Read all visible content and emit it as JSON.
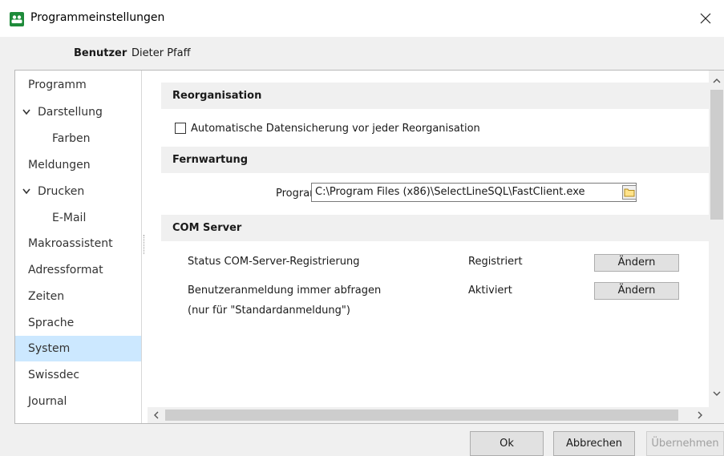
{
  "window": {
    "title": "Programmeinstellungen",
    "close_glyph": "✕"
  },
  "user": {
    "label": "Benutzer",
    "name": "Dieter Pfaff"
  },
  "nav": {
    "items": [
      {
        "label": "Programm"
      },
      {
        "label": "Darstellung",
        "expanded": true
      },
      {
        "label": "Farben"
      },
      {
        "label": "Meldungen"
      },
      {
        "label": "Drucken",
        "expanded": true
      },
      {
        "label": "E-Mail"
      },
      {
        "label": "Makroassistent"
      },
      {
        "label": "Adressformat"
      },
      {
        "label": "Zeiten"
      },
      {
        "label": "Sprache"
      },
      {
        "label": "System",
        "selected": true
      },
      {
        "label": "Swissdec"
      },
      {
        "label": "Journal"
      }
    ]
  },
  "sections": {
    "reorg": {
      "title": "Reorganisation",
      "checkbox_label": "Automatische Datensicherung vor jeder Reorganisation",
      "checked": false
    },
    "fernwartung": {
      "title": "Fernwartung",
      "program_label": "Programm",
      "program_path": "C:\\Program Files (x86)\\SelectLineSQL\\FastClient.exe"
    },
    "com": {
      "title": "COM Server",
      "rows": [
        {
          "label": "Status COM-Server-Registrierung",
          "value": "Registriert",
          "button": "Ändern"
        },
        {
          "label": "Benutzeranmeldung immer abfragen",
          "value": "Aktiviert",
          "button": "Ändern"
        }
      ],
      "note": "(nur für \"Standardanmeldung\")"
    }
  },
  "footer": {
    "ok": "Ok",
    "cancel": "Abbrechen",
    "apply": "Übernehmen"
  },
  "colors": {
    "selected_nav": "#cce8ff",
    "section_bg": "#f0f0f0",
    "app_icon": "#1e8b3a"
  }
}
